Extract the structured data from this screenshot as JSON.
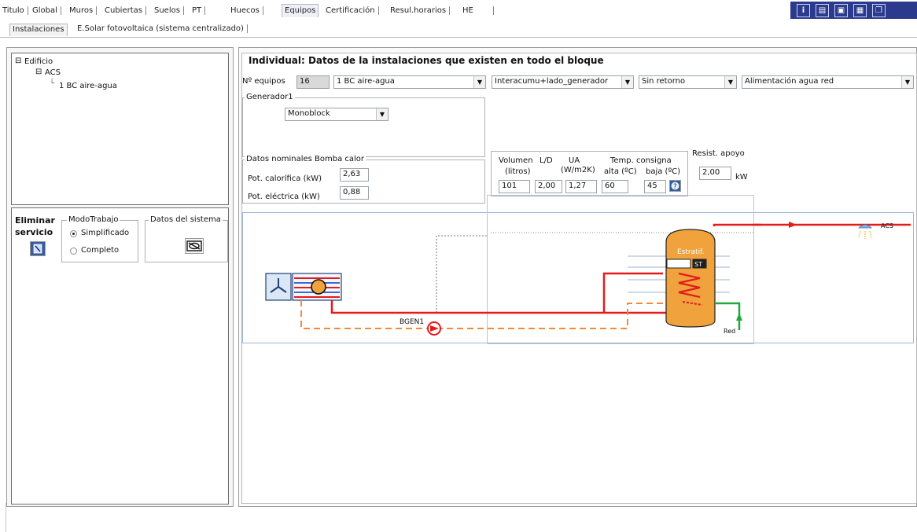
{
  "tabs": [
    "Titulo",
    "Global",
    "Muros",
    "Cubiertas",
    "Suelos",
    "PT",
    "Huecos",
    "Equipos",
    "Certificación",
    "Resul.horarios",
    "HE"
  ],
  "active_tab": "Equipos",
  "subtabs": [
    "Instalaciones",
    "E.Solar fotovoltaica (sistema centralizado)"
  ],
  "active_subtab": "Instalaciones",
  "toolbar_icons": [
    "info-icon",
    "document-icon",
    "disk-icon",
    "window-icon",
    "copy-icon"
  ],
  "tree": {
    "root": "Edificio",
    "child": "ACS",
    "leaf": "1 BC aire-agua"
  },
  "left_actions": {
    "eliminar_line1": "Eliminar",
    "eliminar_line2": "servicio",
    "modo_trabajo_title": "ModoTrabajo",
    "modo_simplificado": "Simplificado",
    "modo_completo": "Completo",
    "datos_sistema_title": "Datos del sistema",
    "selected_mode": "Simplificado"
  },
  "main": {
    "title": "Individual: Datos de la instalaciones que existen en todo el bloque",
    "num_equipos_label": "Nº equipos",
    "num_equipos_value": "16",
    "equipo_select": "1 BC aire-agua",
    "interacumu_select": "Interacumu+lado_generador",
    "retorno_select": "Sin retorno",
    "alimentacion_select": "Alimentación agua red",
    "generador_title": "Generador1",
    "generador_select": "Monoblock",
    "nominal_title": "Datos nominales Bomba calor",
    "pot_calorifica_label": "Pot. calorífica (kW)",
    "pot_calorifica_value": "2,63",
    "pot_electrica_label": "Pot. eléctrica (kW)",
    "pot_electrica_value": "0,88",
    "volumen_label": "Volumen",
    "litros_label": "(litros)",
    "ld_label": "L/D",
    "ua_label": "UA",
    "ua_unit": "(W/m2K)",
    "temp_label": "Temp. consigna",
    "alta_label": "alta (ºC)",
    "baja_label": "baja (ºC)",
    "volumen_value": "101",
    "ld_value": "2,00",
    "ua_value": "1,27",
    "alta_value": "60",
    "baja_value": "45",
    "resist_label": "Resist. apoyo",
    "resist_value": "2,00",
    "resist_unit": "kW"
  },
  "diagram": {
    "pump_label": "BGEN1",
    "tank_label": "Estratif.",
    "st_label": "ST",
    "red_label": "Red",
    "acs_label": "ACS",
    "hot_color": "#e31b1b",
    "return_color": "#f08a3c",
    "cold_color": "#22a83a",
    "tank_color": "#f0a23c"
  }
}
